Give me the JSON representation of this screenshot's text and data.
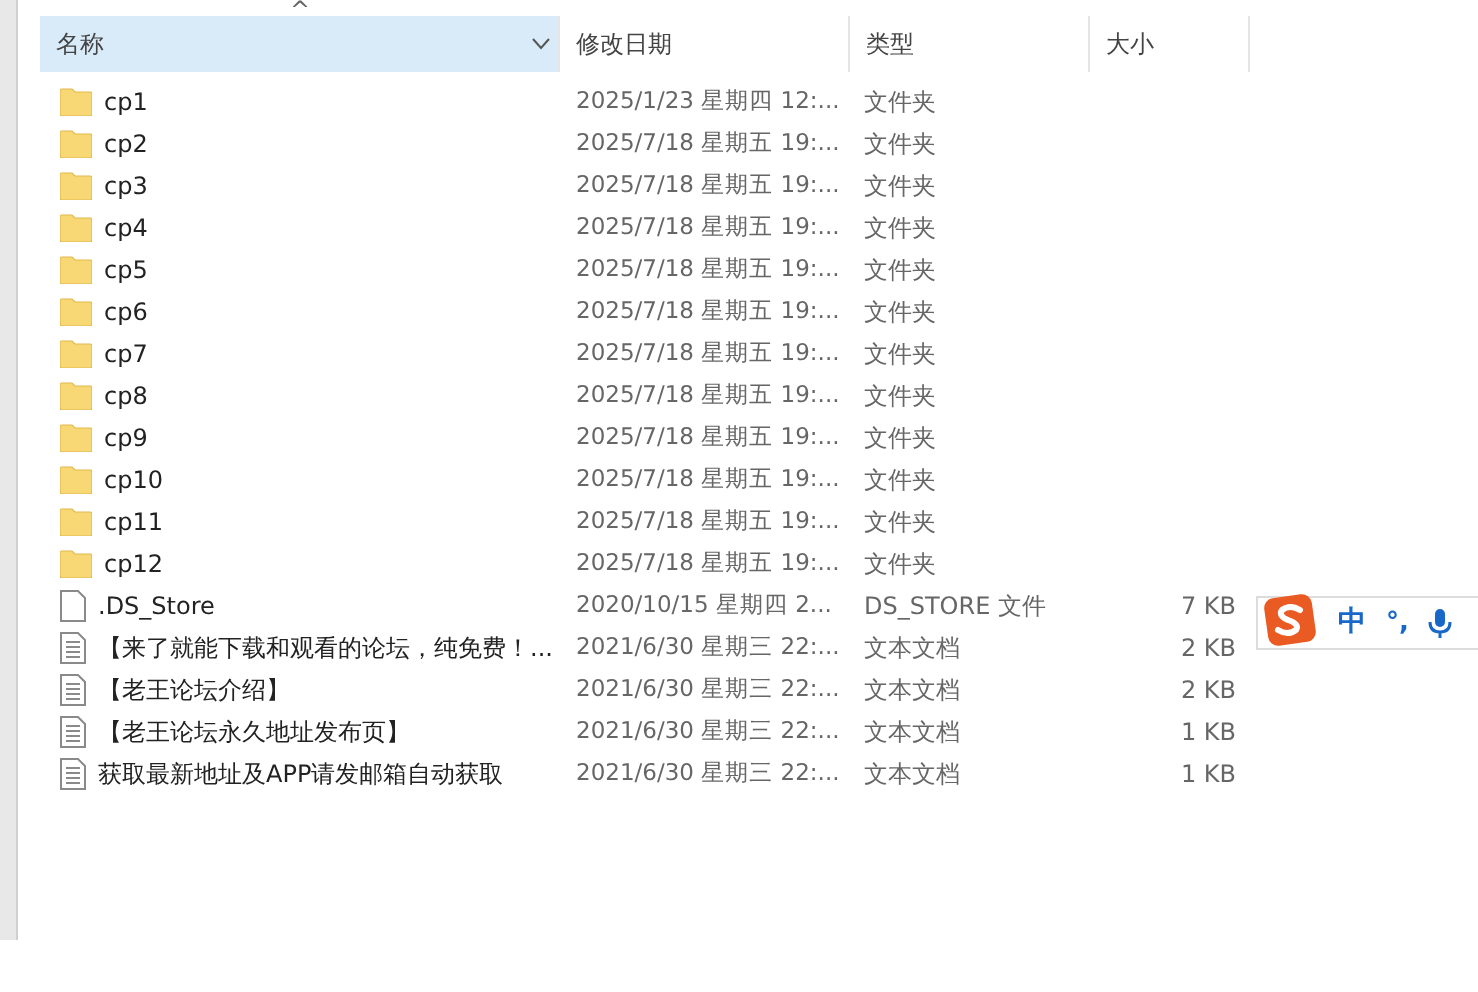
{
  "columns": [
    {
      "label": "名称",
      "selected": true
    },
    {
      "label": "修改日期",
      "selected": false
    },
    {
      "label": "类型",
      "selected": false
    },
    {
      "label": "大小",
      "selected": false
    }
  ],
  "sort_indicator": "^",
  "rows": [
    {
      "kind": "folder",
      "name": "cp1",
      "modified": "2025/1/23 星期四 12:...",
      "type": "文件夹"
    },
    {
      "kind": "folder",
      "name": "cp2",
      "modified": "2025/7/18 星期五 19:...",
      "type": "文件夹"
    },
    {
      "kind": "folder",
      "name": "cp3",
      "modified": "2025/7/18 星期五 19:...",
      "type": "文件夹"
    },
    {
      "kind": "folder",
      "name": "cp4",
      "modified": "2025/7/18 星期五 19:...",
      "type": "文件夹"
    },
    {
      "kind": "folder",
      "name": "cp5",
      "modified": "2025/7/18 星期五 19:...",
      "type": "文件夹"
    },
    {
      "kind": "folder",
      "name": "cp6",
      "modified": "2025/7/18 星期五 19:...",
      "type": "文件夹"
    },
    {
      "kind": "folder",
      "name": "cp7",
      "modified": "2025/7/18 星期五 19:...",
      "type": "文件夹"
    },
    {
      "kind": "folder",
      "name": "cp8",
      "modified": "2025/7/18 星期五 19:...",
      "type": "文件夹"
    },
    {
      "kind": "folder",
      "name": "cp9",
      "modified": "2025/7/18 星期五 19:...",
      "type": "文件夹"
    },
    {
      "kind": "folder",
      "name": "cp10",
      "modified": "2025/7/18 星期五 19:...",
      "type": "文件夹"
    },
    {
      "kind": "folder",
      "name": "cp11",
      "modified": "2025/7/18 星期五 19:...",
      "type": "文件夹"
    },
    {
      "kind": "folder",
      "name": "cp12",
      "modified": "2025/7/18 星期五 19:...",
      "type": "文件夹"
    },
    {
      "kind": "file",
      "name": ".DS_Store",
      "modified": "2020/10/15 星期四 2...",
      "type": "DS_STORE 文件",
      "size": "7 KB"
    },
    {
      "kind": "text",
      "name": "【来了就能下载和观看的论坛，纯免费！...",
      "modified": "2021/6/30 星期三 22:...",
      "type": "文本文档",
      "size": "2 KB"
    },
    {
      "kind": "text",
      "name": "【老王论坛介绍】",
      "modified": "2021/6/30 星期三 22:...",
      "type": "文本文档",
      "size": "2 KB"
    },
    {
      "kind": "text",
      "name": "【老王论坛永久地址发布页】",
      "modified": "2021/6/30 星期三 22:...",
      "type": "文本文档",
      "size": "1 KB"
    },
    {
      "kind": "text",
      "name": "获取最新地址及APP请发邮箱自动获取",
      "modified": "2021/6/30 星期三 22:...",
      "type": "文本文档",
      "size": "1 KB"
    }
  ],
  "ime_bar": {
    "mode": "中",
    "punctuation": "°,"
  }
}
